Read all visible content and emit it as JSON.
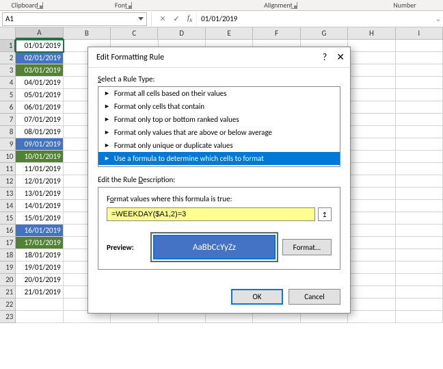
{
  "ribbon": {
    "clipboard": "Clipboard",
    "font": "Font",
    "alignment": "Alignment",
    "number": "Number"
  },
  "namebox": "A1",
  "formula_bar": "01/01/2019",
  "columns": [
    "A",
    "B",
    "C",
    "D",
    "E",
    "F",
    "G",
    "H",
    "I"
  ],
  "rows": [
    {
      "n": 1,
      "v": "01/01/2019",
      "cls": ""
    },
    {
      "n": 2,
      "v": "02/01/2019",
      "cls": "blue"
    },
    {
      "n": 3,
      "v": "03/01/2019",
      "cls": "green"
    },
    {
      "n": 4,
      "v": "04/01/2019",
      "cls": ""
    },
    {
      "n": 5,
      "v": "05/01/2019",
      "cls": ""
    },
    {
      "n": 6,
      "v": "06/01/2019",
      "cls": ""
    },
    {
      "n": 7,
      "v": "07/01/2019",
      "cls": ""
    },
    {
      "n": 8,
      "v": "08/01/2019",
      "cls": ""
    },
    {
      "n": 9,
      "v": "09/01/2019",
      "cls": "blue"
    },
    {
      "n": 10,
      "v": "10/01/2019",
      "cls": "green"
    },
    {
      "n": 11,
      "v": "11/01/2019",
      "cls": ""
    },
    {
      "n": 12,
      "v": "12/01/2019",
      "cls": ""
    },
    {
      "n": 13,
      "v": "13/01/2019",
      "cls": ""
    },
    {
      "n": 14,
      "v": "14/01/2019",
      "cls": ""
    },
    {
      "n": 15,
      "v": "15/01/2019",
      "cls": ""
    },
    {
      "n": 16,
      "v": "16/01/2019",
      "cls": "blue"
    },
    {
      "n": 17,
      "v": "17/01/2019",
      "cls": "green"
    },
    {
      "n": 18,
      "v": "18/01/2019",
      "cls": ""
    },
    {
      "n": 19,
      "v": "19/01/2019",
      "cls": ""
    },
    {
      "n": 20,
      "v": "20/01/2019",
      "cls": ""
    },
    {
      "n": 21,
      "v": "21/01/2019",
      "cls": ""
    },
    {
      "n": 22,
      "v": "",
      "cls": ""
    },
    {
      "n": 23,
      "v": "",
      "cls": ""
    }
  ],
  "dialog": {
    "title": "Edit Formatting Rule",
    "help": "?",
    "select_rule_type": "Select a Rule Type:",
    "rule_types": [
      "Format all cells based on their values",
      "Format only cells that contain",
      "Format only top or bottom ranked values",
      "Format only values that are above or below average",
      "Format only unique or duplicate values",
      "Use a formula to determine which cells to format"
    ],
    "selected_rule_index": 5,
    "edit_description": "Edit the Rule Description:",
    "formula_label": "Format values where this formula is true:",
    "formula_value": "=WEEKDAY($A1,2)=3",
    "preview_label": "Preview:",
    "preview_text": "AaBbCcYyZz",
    "format_btn": "Format...",
    "ok": "OK",
    "cancel": "Cancel"
  }
}
